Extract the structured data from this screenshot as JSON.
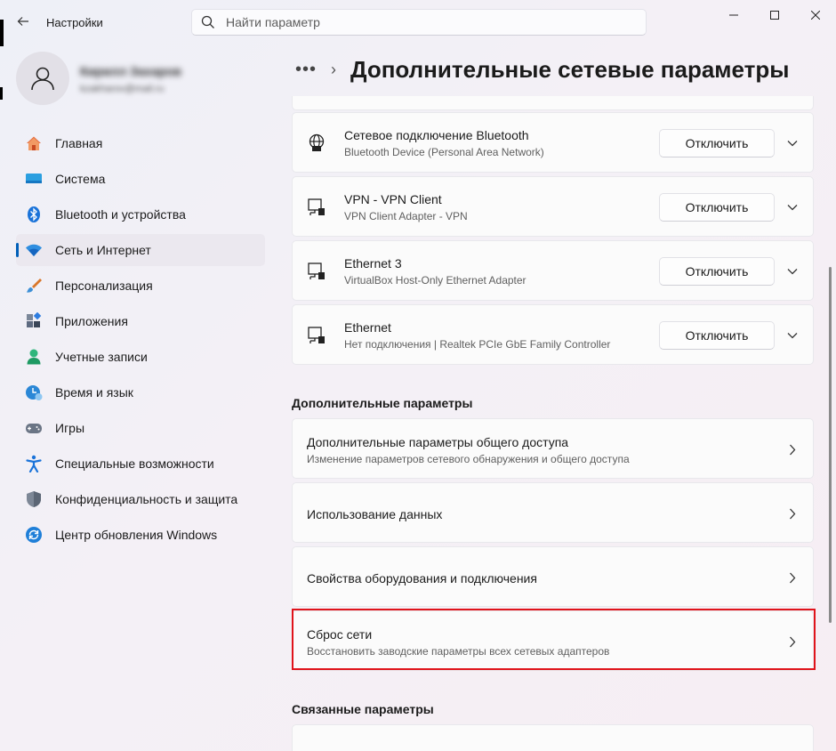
{
  "window": {
    "title": "Настройки",
    "controls": {
      "minimize": "minimize-icon",
      "maximize": "maximize-icon",
      "close": "close-icon"
    }
  },
  "search": {
    "placeholder": "Найти параметр"
  },
  "user": {
    "name": "Кирилл Захаров",
    "email": "kzakharov@mail.ru"
  },
  "sidebar": {
    "items": [
      {
        "label": "Главная",
        "icon": "home-icon",
        "active": false
      },
      {
        "label": "Система",
        "icon": "system-icon",
        "active": false
      },
      {
        "label": "Bluetooth и устройства",
        "icon": "bluetooth-icon",
        "active": false
      },
      {
        "label": "Сеть и Интернет",
        "icon": "network-icon",
        "active": true
      },
      {
        "label": "Персонализация",
        "icon": "brush-icon",
        "active": false
      },
      {
        "label": "Приложения",
        "icon": "apps-icon",
        "active": false
      },
      {
        "label": "Учетные записи",
        "icon": "accounts-icon",
        "active": false
      },
      {
        "label": "Время и язык",
        "icon": "time-language-icon",
        "active": false
      },
      {
        "label": "Игры",
        "icon": "gamepad-icon",
        "active": false
      },
      {
        "label": "Специальные возможности",
        "icon": "accessibility-icon",
        "active": false
      },
      {
        "label": "Конфиденциальность и защита",
        "icon": "shield-icon",
        "active": false
      },
      {
        "label": "Центр обновления Windows",
        "icon": "update-icon",
        "active": false
      }
    ]
  },
  "breadcrumb": {
    "more": "•••",
    "separator": "›",
    "title": "Дополнительные сетевые параметры"
  },
  "adapters": [
    {
      "name": "Сетевое подключение Bluetooth",
      "desc": "Bluetooth Device (Personal Area Network)",
      "button": "Отключить",
      "icon": "globe-network-icon"
    },
    {
      "name": "VPN - VPN Client",
      "desc": "VPN Client Adapter - VPN",
      "button": "Отключить",
      "icon": "ethernet-icon"
    },
    {
      "name": "Ethernet 3",
      "desc": "VirtualBox Host-Only Ethernet Adapter",
      "button": "Отключить",
      "icon": "ethernet-icon"
    },
    {
      "name": "Ethernet",
      "desc": "Нет подключения | Realtek PCIe GbE Family Controller",
      "button": "Отключить",
      "icon": "ethernet-icon"
    }
  ],
  "more_settings": {
    "heading": "Дополнительные параметры",
    "items": [
      {
        "title": "Дополнительные параметры общего доступа",
        "sub": "Изменение параметров сетевого обнаружения и общего доступа"
      },
      {
        "title": "Использование данных",
        "sub": ""
      },
      {
        "title": "Свойства оборудования и подключения",
        "sub": ""
      },
      {
        "title": "Сброс сети",
        "sub": "Восстановить заводские параметры всех сетевых адаптеров"
      }
    ]
  },
  "related": {
    "heading": "Связанные параметры"
  },
  "colors": {
    "accent": "#005fb8",
    "highlight": "#e0141b"
  }
}
